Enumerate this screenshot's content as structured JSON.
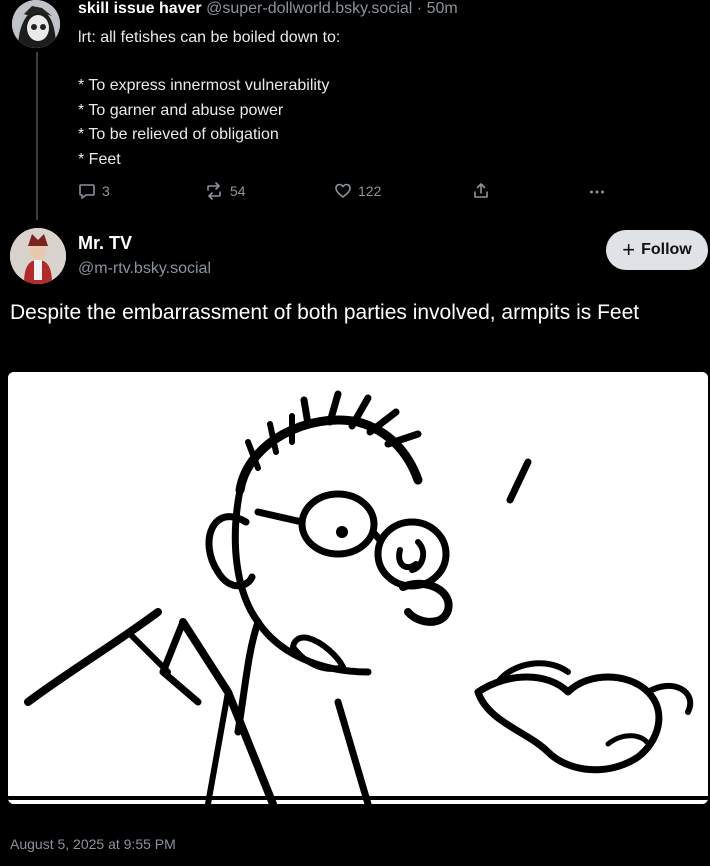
{
  "post1": {
    "author_name": "skill issue haver",
    "author_handle": "@super-dollworld.bsky.social",
    "separator": "·",
    "time": "50m",
    "reply_text": "lrt: all fetishes can be boiled down to:",
    "bullets": [
      "* To express innermost vulnerability",
      "* To garner and abuse power",
      "* To be relieved of obligation",
      "* Feet"
    ],
    "actions": {
      "reply_icon": "speech-bubble-icon",
      "reply_count": "3",
      "repost_icon": "repost-icon",
      "repost_count": "54",
      "like_icon": "heart-icon",
      "like_count": "122",
      "share_icon": "share-icon",
      "more_icon": "more-icon"
    }
  },
  "post2": {
    "author_name": "Mr. TV",
    "author_handle": "@m-rtv.bsky.social",
    "follow_label": "Follow",
    "follow_icon": "plus-icon",
    "text": "Despite the embarrassment of both parties involved, armpits is Feet",
    "timestamp": "August 5, 2025 at 9:55 PM"
  },
  "colors": {
    "background": "#000000",
    "primary_text": "#ffffff",
    "muted_text": "#8b939c",
    "follow_button": "#dfe3e8",
    "thread_line": "#3a3f45"
  }
}
